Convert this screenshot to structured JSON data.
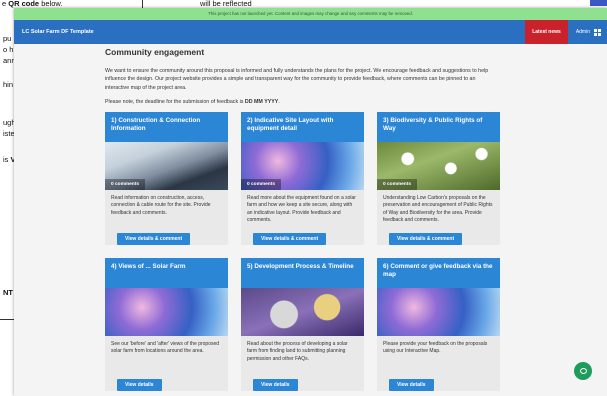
{
  "background_doc": {
    "frag1_pre": "e ",
    "frag1_bold": "QR code",
    "frag1_post": " below.",
    "frag2": "will be reflected",
    "frag3": "pu",
    "frag4": "o h",
    "frag5": "ann",
    "frag6": "hin",
    "frag7": "ugh",
    "frag8": "iste",
    "frag9_pre": "is ",
    "frag9_bold": "V",
    "frag10": "NT"
  },
  "app": {
    "notice": "This project has not launched yet. Content and images may change and any comments may be removed.",
    "brand": "LC Solar Farm DF Template",
    "latest_news": "Latest news",
    "admin": "Admin",
    "title": "Community engagement",
    "intro": "We want to ensure the community around this proposal is informed and fully understands the plans for the project. We encourage feedback and suggestions to help influence the design. Our project website provides a simple and transparent way for the community to provide feedback, where comments can be pinned to an interactive map of the project area.",
    "deadline_pre": "Please note, the deadline for the submission of feedback is ",
    "deadline_bold": "DD MM YYYY",
    "deadline_post": ".",
    "cards": [
      {
        "title": "1) Construction & Connection Information",
        "badge": "0 comments",
        "description": "Read information on construction, access, connection & cable route for the site. Provide feedback and comments.",
        "button": "View details & comment"
      },
      {
        "title": "2) Indicative Site Layout with equipment detail",
        "badge": "0 comments",
        "description": "Read more about the equipment found on a solar farm and how we keep a site secure, along with an indicative layout. Provide feedback and comments.",
        "button": "View details & comment"
      },
      {
        "title": "3) Biodiversity & Public Rights of Way",
        "badge": "0 comments",
        "description": "Understanding Low Carbon's proposals on the preservation and encouragement of Public Rights of Way and Biodiversity for the area. Provide feedback and comments.",
        "button": "View details & comment"
      },
      {
        "title": "4) Views of ... Solar Farm",
        "badge": "",
        "description": "See our 'before' and 'after' views of the proposed solar farm from locations around the area.",
        "button": "View details"
      },
      {
        "title": "5) Development Process & Timeline",
        "badge": "",
        "description": "Read about the process of developing a solar farm from finding land to submitting planning permission and other FAQs.",
        "button": "View details"
      },
      {
        "title": "6) Comment or give feedback via the map",
        "badge": "",
        "description": "Please provide your feedback on the proposals using our Interactive Map.",
        "button": "View details"
      }
    ]
  },
  "icons": {
    "apps": "grid-icon",
    "chat": "chat-icon"
  },
  "colors": {
    "primary": "#2b86d6",
    "header": "#2b6fc0",
    "alert": "#c9222a",
    "notice": "#8fe08f",
    "chat": "#1e9c5a"
  }
}
